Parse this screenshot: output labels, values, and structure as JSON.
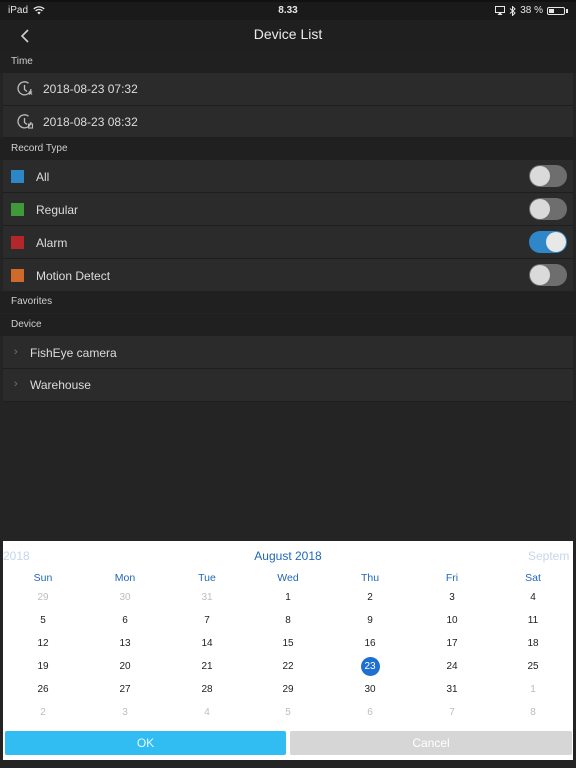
{
  "status": {
    "device": "iPad",
    "time": "8.33",
    "battery": "38 %",
    "battery_level": 0.38
  },
  "nav": {
    "title": "Device List",
    "back_icon": "chevron-left-icon"
  },
  "time_section": {
    "header": "Time",
    "start": "2018-08-23 07:32",
    "end": "2018-08-23 08:32"
  },
  "record_type": {
    "header": "Record Type",
    "items": [
      {
        "label": "All",
        "color": "#2d87c7",
        "on": false
      },
      {
        "label": "Regular",
        "color": "#3f9a3a",
        "on": false
      },
      {
        "label": "Alarm",
        "color": "#b3262a",
        "on": true
      },
      {
        "label": "Motion Detect",
        "color": "#d06a2a",
        "on": false
      }
    ]
  },
  "favorites": {
    "header": "Favorites"
  },
  "device": {
    "header": "Device",
    "items": [
      {
        "label": "FishEye camera"
      },
      {
        "label": "Warehouse"
      }
    ]
  },
  "calendar": {
    "prev_month": "2018",
    "current_month": "August 2018",
    "next_month": "Septem",
    "weekdays": [
      "Sun",
      "Mon",
      "Tue",
      "Wed",
      "Thu",
      "Fri",
      "Sat"
    ],
    "weeks": [
      [
        "29",
        "30",
        "31",
        "1",
        "2",
        "3",
        "4"
      ],
      [
        "5",
        "6",
        "7",
        "8",
        "9",
        "10",
        "11"
      ],
      [
        "12",
        "13",
        "14",
        "15",
        "16",
        "17",
        "18"
      ],
      [
        "19",
        "20",
        "21",
        "22",
        "23",
        "24",
        "25"
      ],
      [
        "26",
        "27",
        "28",
        "29",
        "30",
        "31",
        "1"
      ],
      [
        "2",
        "3",
        "4",
        "5",
        "6",
        "7",
        "8"
      ]
    ],
    "selected": "23"
  },
  "buttons": {
    "ok": "OK",
    "cancel": "Cancel"
  }
}
